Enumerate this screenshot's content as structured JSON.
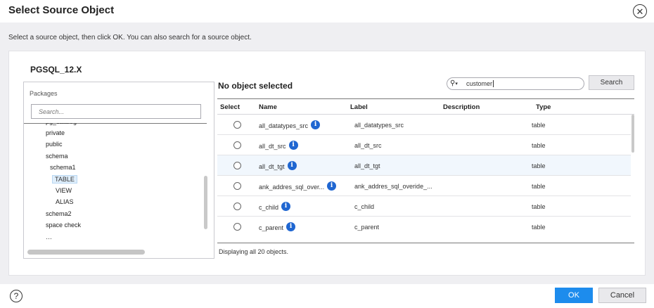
{
  "dialog": {
    "title": "Select Source Object",
    "instruction": "Select a source object, then click OK. You can also search for a source object."
  },
  "connection": {
    "name": "PGSQL_12.X"
  },
  "tree": {
    "packages_label": "Packages",
    "search_placeholder": "Search...",
    "items": [
      {
        "label": "pg_catalog"
      },
      {
        "label": "private"
      },
      {
        "label": "public"
      },
      {
        "label": "schema"
      },
      {
        "label": "schema1"
      },
      {
        "label": "TABLE",
        "selected": true
      },
      {
        "label": "VIEW"
      },
      {
        "label": "ALIAS"
      },
      {
        "label": "schema2"
      },
      {
        "label": "space check"
      },
      {
        "label": "…"
      }
    ]
  },
  "objects": {
    "selection_title": "No object selected",
    "search_value": "customer",
    "search_button": "Search",
    "columns": {
      "select": "Select",
      "name": "Name",
      "label": "Label",
      "description": "Description",
      "type": "Type"
    },
    "rows": [
      {
        "name": "all_datatypes_src",
        "label": "all_datatypes_src",
        "description": "",
        "type": "table"
      },
      {
        "name": "all_dt_src",
        "label": "all_dt_src",
        "description": "",
        "type": "table"
      },
      {
        "name": "all_dt_tgt",
        "label": "all_dt_tgt",
        "description": "",
        "type": "table"
      },
      {
        "name": "ank_addres_sql_over...",
        "label": "ank_addres_sql_overide_...",
        "description": "",
        "type": "table"
      },
      {
        "name": "c_child",
        "label": "c_child",
        "description": "",
        "type": "table"
      },
      {
        "name": "c_parent",
        "label": "c_parent",
        "description": "",
        "type": "table"
      }
    ],
    "footer": "Displaying all 20 objects."
  },
  "buttons": {
    "ok": "OK",
    "cancel": "Cancel"
  },
  "icons": {
    "close": "close-icon",
    "help": "help-icon",
    "search": "search-icon",
    "info": "info-icon"
  },
  "colors": {
    "primary": "#1d8ced",
    "info": "#1f66d1",
    "background": "#efeff2"
  }
}
